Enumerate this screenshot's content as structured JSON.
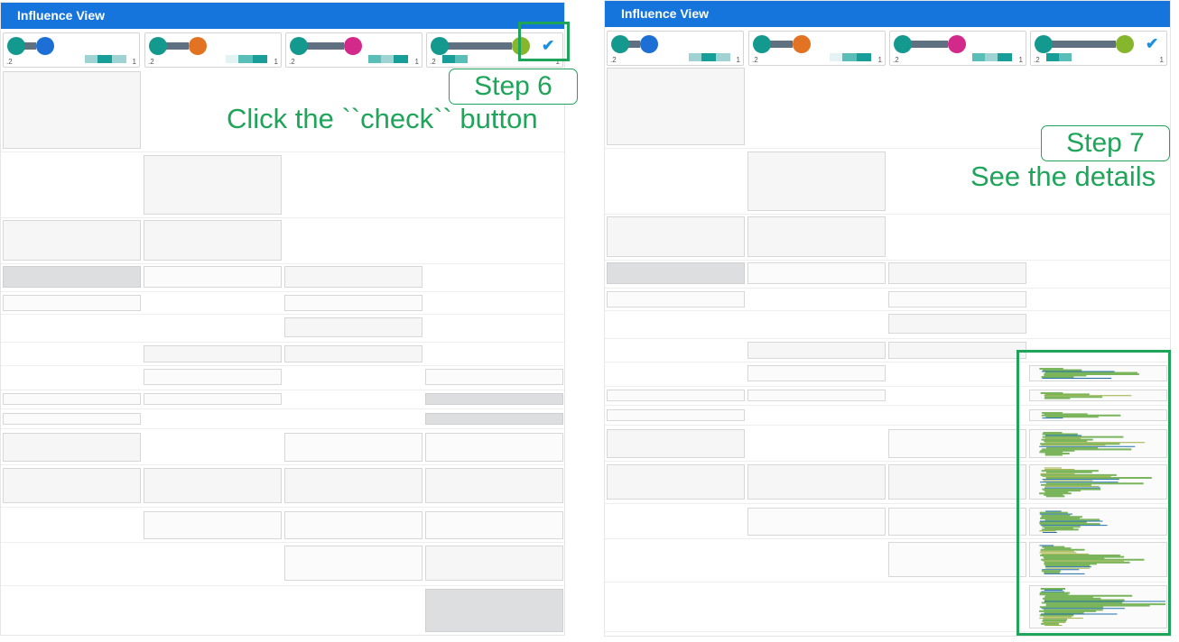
{
  "panels": [
    {
      "title": "Influence View"
    },
    {
      "title": "Influence View"
    }
  ],
  "cards": [
    {
      "source_color": "#14998f",
      "target_color": "#1d6fd6",
      "min_label": ".2",
      "max_label": "1"
    },
    {
      "source_color": "#14998f",
      "target_color": "#e27323",
      "min_label": ".2",
      "max_label": "1"
    },
    {
      "source_color": "#14998f",
      "target_color": "#d3298a",
      "min_label": ".2",
      "max_label": "1"
    },
    {
      "source_color": "#14998f",
      "target_color": "#86b62c",
      "min_label": ".2",
      "max_label": "1",
      "check_icon": "check-icon"
    }
  ],
  "annotations": {
    "step6": {
      "label": "Step 6",
      "text": "Click the ``check`` button"
    },
    "step7": {
      "label": "Step 7",
      "text": "See the details"
    }
  },
  "colors": {
    "header": "#1675dc",
    "annotation": "#1fa55a",
    "detail_green": "#7ab55c",
    "detail_blue": "#1f6fa8",
    "detail_olive": "#9cae3a"
  }
}
